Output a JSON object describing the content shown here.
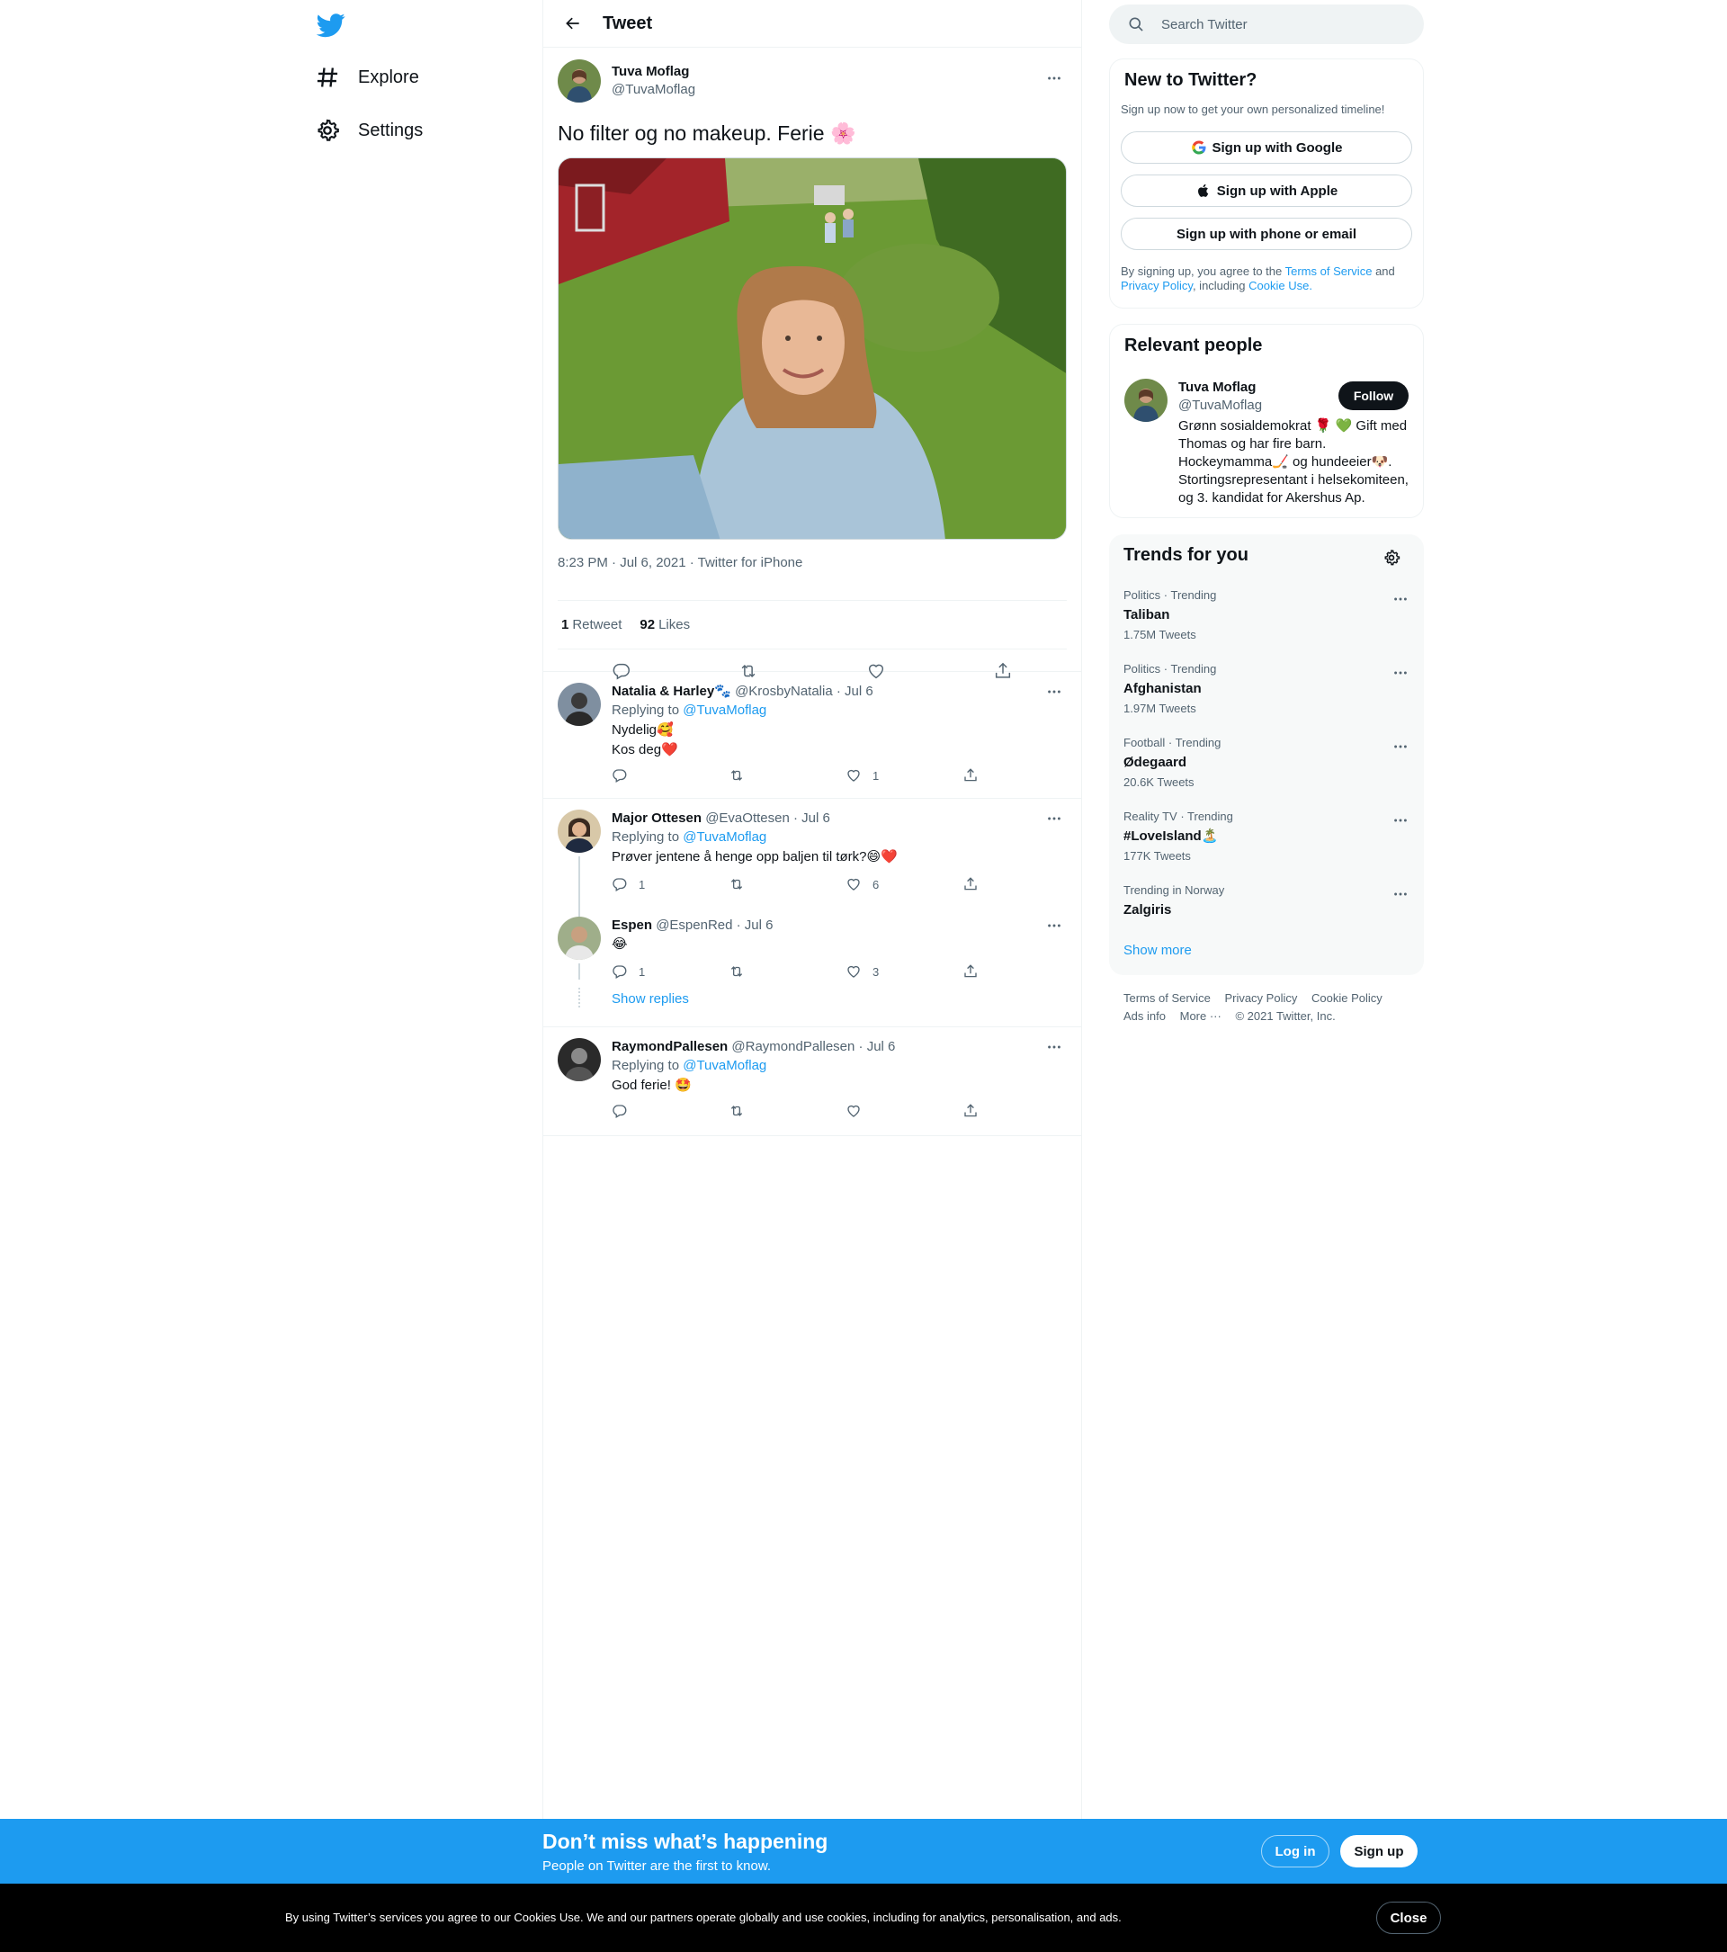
{
  "nav": {
    "items": [
      {
        "label": "Explore",
        "icon": "hashtag-icon"
      },
      {
        "label": "Settings",
        "icon": "gear-icon"
      }
    ]
  },
  "header": {
    "title": "Tweet"
  },
  "tweet": {
    "name": "Tuva Moflag",
    "handle": "@TuvaMoflag",
    "text": "No filter og no makeup. Ferie 🌸",
    "meta": "8:23 PM · Jul 6, 2021 · Twitter for iPhone",
    "retweet_count": "1",
    "retweet_label": "Retweet",
    "like_count": "92",
    "like_label": "Likes"
  },
  "replies": [
    {
      "name": "Natalia & Harley🐾",
      "handle": "@KrosbyNatalia",
      "date": "· Jul 6",
      "replying_prefix": "Replying to",
      "replying_to": "@TuvaMoflag",
      "lines": [
        "Nydelig🥰",
        "Kos deg❤️"
      ],
      "replies": "",
      "retweets": "",
      "likes": "1"
    },
    {
      "name": "Major Ottesen",
      "handle": "@EvaOttesen",
      "date": "· Jul 6",
      "replying_prefix": "Replying to",
      "replying_to": "@TuvaMoflag",
      "lines": [
        "Prøver jentene å henge opp baljen til tørk?😄❤️"
      ],
      "replies": "1",
      "retweets": "",
      "likes": "6"
    },
    {
      "name": "Espen",
      "handle": "@EspenRed",
      "date": "· Jul 6",
      "lines": [
        "😂"
      ],
      "replies": "1",
      "retweets": "",
      "likes": "3"
    },
    {
      "name": "RaymondPallesen",
      "handle": "@RaymondPallesen",
      "date": "· Jul 6",
      "replying_prefix": "Replying to",
      "replying_to": "@TuvaMoflag",
      "lines": [
        "God ferie! 🤩"
      ],
      "replies": "",
      "retweets": "",
      "likes": ""
    }
  ],
  "show_replies": "Show replies",
  "search": {
    "placeholder": "Search Twitter"
  },
  "new_to_twitter": {
    "title": "New to Twitter?",
    "subtitle": "Sign up now to get your own personalized timeline!",
    "google": "Sign up with Google",
    "apple": "Sign up with Apple",
    "phone": "Sign up with phone or email",
    "legal_1": "By signing up, you agree to the",
    "tos": "Terms of Service",
    "and": "and",
    "privacy": "Privacy Policy",
    "including": ", including",
    "cookie": "Cookie Use."
  },
  "relevant": {
    "title": "Relevant people",
    "name": "Tuva Moflag",
    "handle": "@TuvaMoflag",
    "follow": "Follow",
    "bio": "Grønn sosialdemokrat 🌹 💚 Gift med Thomas og har fire barn. Hockeymamma🏒 og hundeeier🐶. Stortingsrepresentant i helsekomiteen, og 3. kandidat for Akershus Ap."
  },
  "trends": {
    "title": "Trends for you",
    "items": [
      {
        "category": "Politics · Trending",
        "name": "Taliban",
        "count": "1.75M Tweets"
      },
      {
        "category": "Politics · Trending",
        "name": "Afghanistan",
        "count": "1.97M Tweets"
      },
      {
        "category": "Football · Trending",
        "name": "Ødegaard",
        "count": "20.6K Tweets"
      },
      {
        "category": "Reality TV · Trending",
        "name": "#LoveIsland🏝️",
        "count": "177K Tweets"
      },
      {
        "category": "Trending in Norway",
        "name": "Zalgiris",
        "count": ""
      }
    ],
    "show_more": "Show more"
  },
  "footer": {
    "tos": "Terms of Service",
    "privacy": "Privacy Policy",
    "cookie": "Cookie Policy",
    "ads": "Ads info",
    "more": "More ···",
    "copyright": "© 2021 Twitter, Inc."
  },
  "signup_bar": {
    "title": "Don’t miss what’s happening",
    "subtitle": "People on Twitter are the first to know.",
    "login": "Log in",
    "signup": "Sign up"
  },
  "cookie_bar": {
    "message": "By using Twitter’s services you agree to our Cookies Use. We and our partners operate globally and use cookies, including for analytics, personalisation, and ads.",
    "close": "Close"
  },
  "colors": {
    "accent": "#1d9bf0",
    "text": "#0f1419",
    "muted": "#536471",
    "border": "#eff3f4"
  }
}
